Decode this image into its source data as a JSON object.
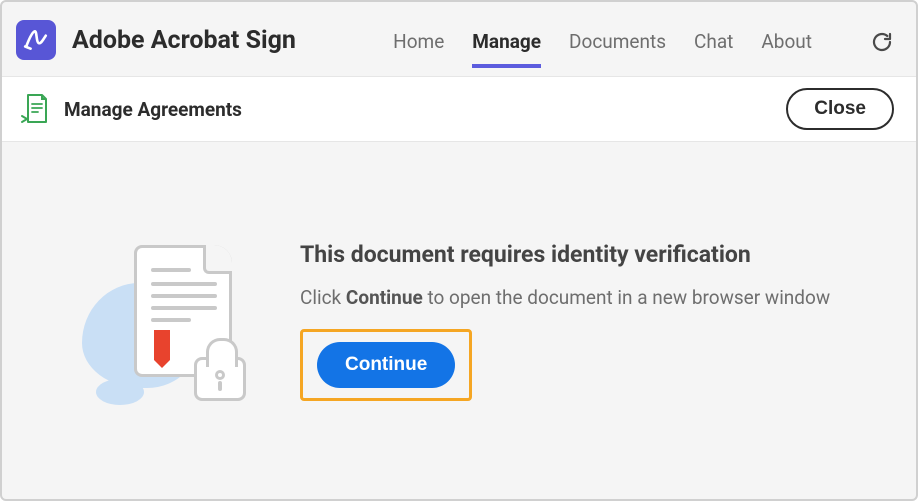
{
  "header": {
    "app_title": "Adobe Acrobat Sign",
    "nav": [
      {
        "label": "Home",
        "active": false
      },
      {
        "label": "Manage",
        "active": true
      },
      {
        "label": "Documents",
        "active": false
      },
      {
        "label": "Chat",
        "active": false
      },
      {
        "label": "About",
        "active": false
      }
    ]
  },
  "subheader": {
    "title": "Manage Agreements",
    "close_label": "Close"
  },
  "message": {
    "title": "This document requires identity verification",
    "body_prefix": "Click ",
    "body_strong": "Continue",
    "body_suffix": " to open the document in a new browser window",
    "continue_label": "Continue"
  }
}
